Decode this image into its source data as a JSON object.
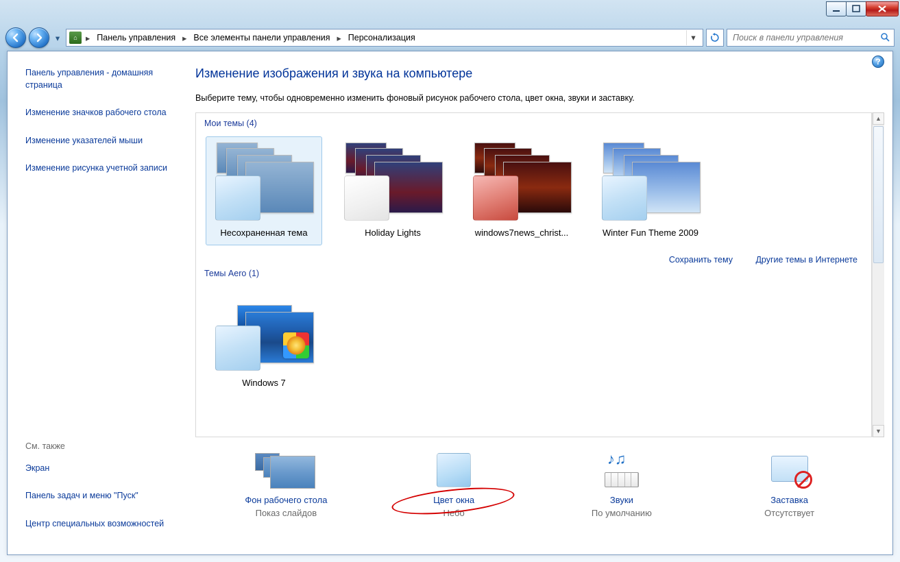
{
  "breadcrumbs": {
    "item0": "Панель управления",
    "item1": "Все элементы панели управления",
    "item2": "Персонализация"
  },
  "search": {
    "placeholder": "Поиск в панели управления"
  },
  "sidebar": {
    "home": "Панель управления - домашняя страница",
    "link1": "Изменение значков рабочего стола",
    "link2": "Изменение указателей мыши",
    "link3": "Изменение рисунка учетной записи",
    "seeAlsoHead": "См. также",
    "see1": "Экран",
    "see2": "Панель задач и меню \"Пуск\"",
    "see3": "Центр специальных возможностей"
  },
  "page": {
    "title": "Изменение изображения и звука на компьютере",
    "desc": "Выберите тему, чтобы одновременно изменить фоновый рисунок рабочего стола, цвет окна, звуки и заставку."
  },
  "sections": {
    "myThemes": "Мои темы (4)",
    "aero": "Темы Aero (1)"
  },
  "themes": {
    "t1": "Несохраненная тема",
    "t2": "Holiday Lights",
    "t3": "windows7news_christ...",
    "t4": "Winter Fun Theme 2009",
    "aero1": "Windows 7"
  },
  "actions": {
    "save": "Сохранить тему",
    "online": "Другие темы в Интернете"
  },
  "bottom": {
    "bg_label": "Фон рабочего стола",
    "bg_desc": "Показ слайдов",
    "color_label": "Цвет окна",
    "color_desc": "Небо",
    "sound_label": "Звуки",
    "sound_desc": "По умолчанию",
    "saver_label": "Заставка",
    "saver_desc": "Отсутствует"
  }
}
